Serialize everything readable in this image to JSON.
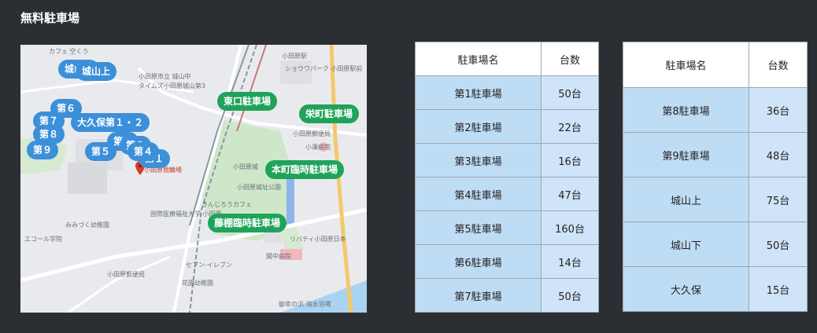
{
  "page": {
    "title": "無料駐車場"
  },
  "map": {
    "labels": {
      "cafe": "カフェ 空くう",
      "odawara_office": "小田原市立 城山中",
      "times": "タイムズ小田原城山第3",
      "station": "小田原駅",
      "shiyou": "ショウワパーク 小田原駅前",
      "kawara": "小田原郵便局",
      "clinic": "小澤病院",
      "castle": "小田原城",
      "castle_park": "小田原城址公園",
      "hotel": "リバティ小田原日本",
      "kinjiro": "きんじろうカフェ",
      "university": "国際医療福祉大学 小田原",
      "kindergarten": "みみづく幼稚園",
      "eko": "エコール学院",
      "seven": "セブン-イレブン",
      "post": "小田原郵便局",
      "karaku": "花園幼稚園",
      "gomi": "御幸の浜 海水浴場",
      "meiji": "間中病院",
      "red_pin": "小田原競輪場"
    },
    "markers": {
      "m1": "城山下",
      "m2": "城山上",
      "m3": "第６",
      "m4": "第７",
      "m5": "第８",
      "m6": "大久保第１・２",
      "m7": "第９",
      "m8": "第５",
      "m9": "第３",
      "m10": "第２",
      "m11": "第１",
      "m12": "第４",
      "g1": "東口駐車場",
      "g2": "栄町駐車場",
      "g3": "本町臨時駐車場",
      "g4": "藤棚臨時駐車場"
    }
  },
  "table_left": {
    "headers": [
      "駐車場名",
      "台数"
    ],
    "rows": [
      [
        "第1駐車場",
        "50台"
      ],
      [
        "第2駐車場",
        "22台"
      ],
      [
        "第3駐車場",
        "16台"
      ],
      [
        "第4駐車場",
        "47台"
      ],
      [
        "第5駐車場",
        "160台"
      ],
      [
        "第6駐車場",
        "14台"
      ],
      [
        "第7駐車場",
        "50台"
      ]
    ]
  },
  "table_right": {
    "headers": [
      "駐車場名",
      "台数"
    ],
    "rows": [
      [
        "第8駐車場",
        "36台"
      ],
      [
        "第9駐車場",
        "48台"
      ],
      [
        "城山上",
        "75台"
      ],
      [
        "城山下",
        "50台"
      ],
      [
        "大久保",
        "15台"
      ]
    ]
  }
}
